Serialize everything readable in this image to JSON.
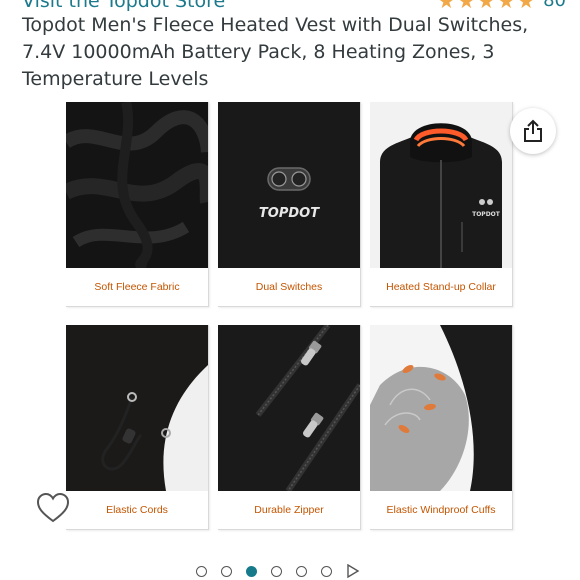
{
  "store": {
    "link_text": "Visit the Topdot Store"
  },
  "rating": {
    "stars": 4.5,
    "count": "80"
  },
  "product": {
    "title": "Topdot Men's Fleece Heated Vest with Dual Switches, 7.4V 10000mAh Battery Pack, 8 Heating Zones, 3 Temperature Levels"
  },
  "gallery": {
    "images": [
      {
        "label": "Soft Fleece Fabric"
      },
      {
        "label": "Dual Switches",
        "logo_text": "TOPDOT"
      },
      {
        "label": "Heated Stand-up Collar",
        "logo_text": "TOPDOT"
      },
      {
        "label": "Elastic Cords"
      },
      {
        "label": "Durable Zipper"
      },
      {
        "label": "Elastic Windproof Cuffs"
      }
    ]
  },
  "carousel": {
    "total": 6,
    "active_index": 2
  },
  "icons": {
    "share": "share-icon",
    "wishlist": "heart-icon",
    "play": "play-icon"
  },
  "colors": {
    "link": "#1d7a8c",
    "star": "#f3a847",
    "caption": "#c45500",
    "active_dot": "#167a8a"
  }
}
